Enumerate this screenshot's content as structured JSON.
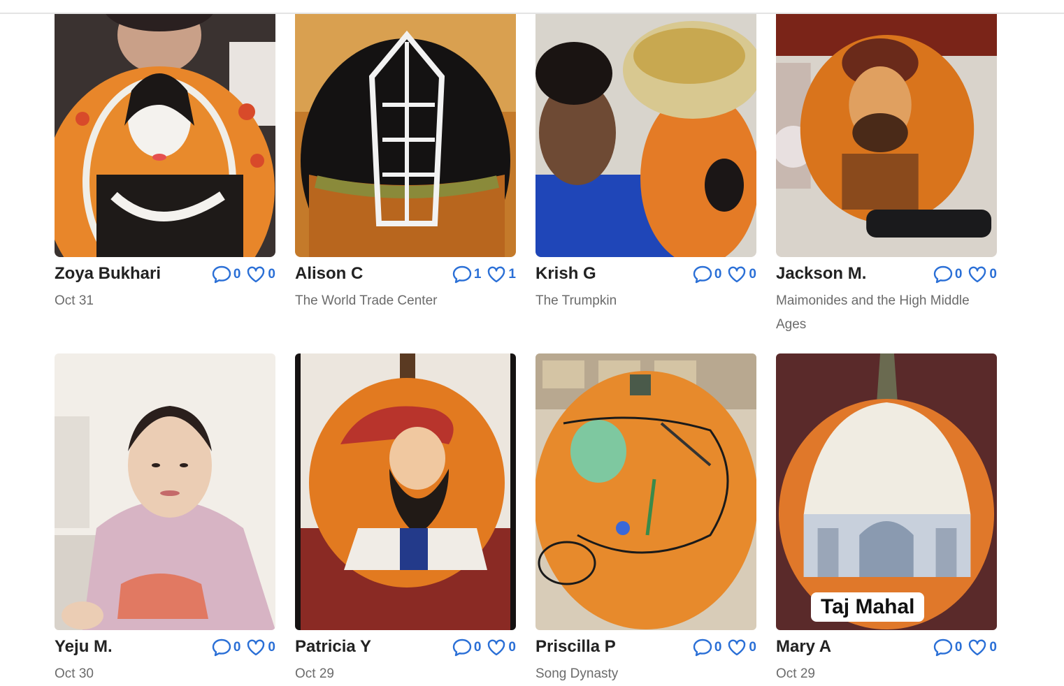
{
  "cards": [
    {
      "name": "Zoya Bukhari",
      "comments": "0",
      "likes": "0",
      "subtitle": "Oct 31"
    },
    {
      "name": "Alison C",
      "comments": "1",
      "likes": "1",
      "subtitle": "The World Trade Center"
    },
    {
      "name": "Krish G",
      "comments": "0",
      "likes": "0",
      "subtitle": "The Trumpkin"
    },
    {
      "name": "Jackson M.",
      "comments": "0",
      "likes": "0",
      "subtitle": "Maimonides and the High Middle Ages"
    },
    {
      "name": "Yeju M.",
      "comments": "0",
      "likes": "0",
      "subtitle": "Oct 30"
    },
    {
      "name": "Patricia Y",
      "comments": "0",
      "likes": "0",
      "subtitle": "Oct 29"
    },
    {
      "name": "Priscilla P",
      "comments": "0",
      "likes": "0",
      "subtitle": "Song Dynasty"
    },
    {
      "name": "Mary A",
      "comments": "0",
      "likes": "0",
      "subtitle": "Oct 29",
      "overlay": "Taj Mahal"
    }
  ],
  "colors": {
    "accent": "#2a6fd6",
    "name": "#222222",
    "subtitle": "#6b6b6b"
  },
  "icons": {
    "comment": "comment-icon",
    "like": "heart-icon"
  }
}
